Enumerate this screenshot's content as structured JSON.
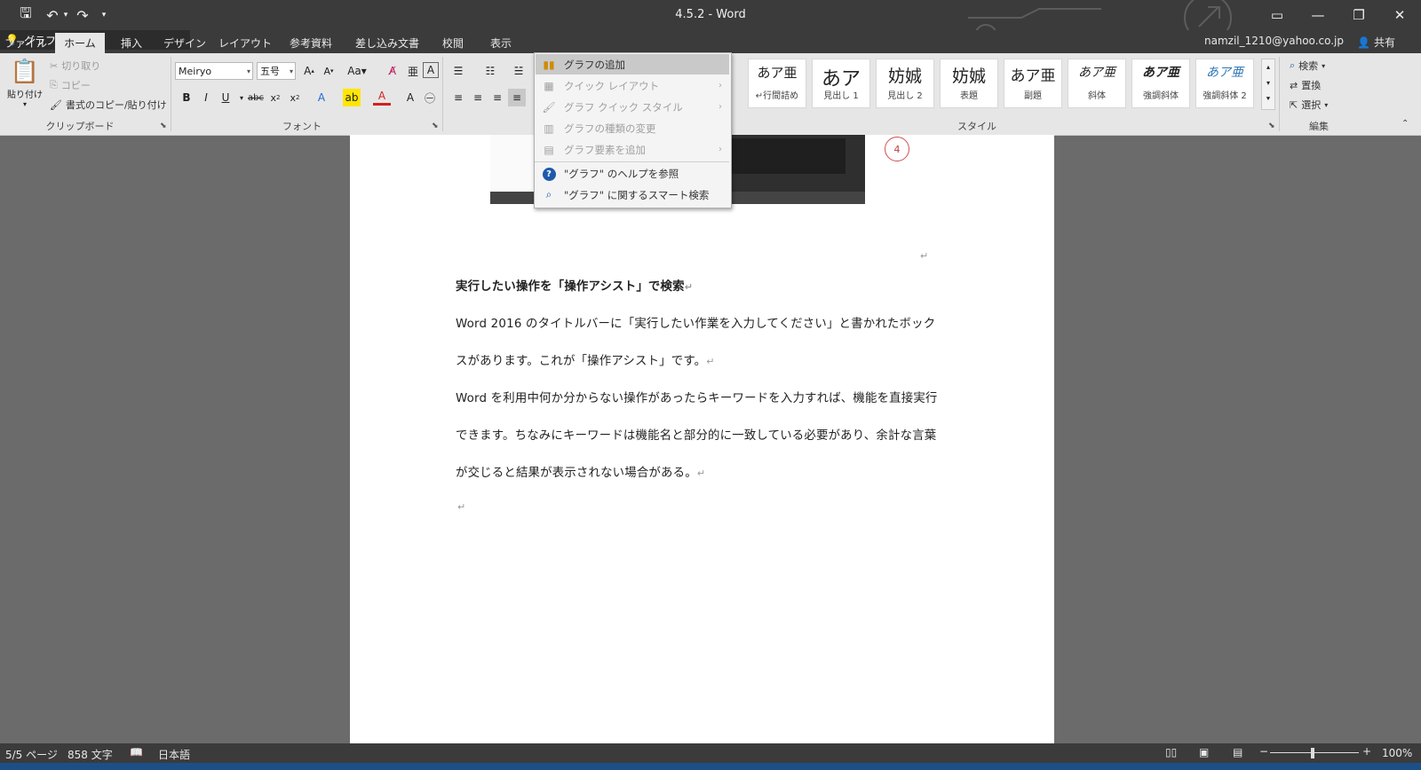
{
  "app": {
    "window_title": "4.5.2 - Word",
    "account": "namzil_1210@yahoo.co.jp",
    "share_label": "共有"
  },
  "tabs": [
    "ファイル",
    "ホーム",
    "挿入",
    "デザイン",
    "レイアウト",
    "参考資料",
    "差し込み文書",
    "校閲",
    "表示"
  ],
  "active_tab": "ホーム",
  "tell_me": {
    "value": "グラフ"
  },
  "ribbon": {
    "clipboard": {
      "paste": "貼り付け",
      "cut": "切り取り",
      "copy": "コピー",
      "format_painter": "書式のコピー/貼り付け",
      "group_label": "クリップボード"
    },
    "font": {
      "font_name": "Meiryo",
      "font_size": "五号",
      "group_label": "フォント"
    },
    "styles": {
      "group_label": "スタイル",
      "items": [
        {
          "sample": "あア亜",
          "name": "↵行間詰め"
        },
        {
          "sample": "あア",
          "name": "見出し 1"
        },
        {
          "sample": "妨娍",
          "name": "見出し 2"
        },
        {
          "sample": "妨娍",
          "name": "表題"
        },
        {
          "sample": "あア亜",
          "name": "副題"
        },
        {
          "sample": "あア亜",
          "name": "斜体"
        },
        {
          "sample": "あア亜",
          "name": "強調斜体"
        },
        {
          "sample": "あア亜",
          "name": "強調斜体 2"
        }
      ]
    },
    "editing": {
      "find": "検索",
      "replace": "置換",
      "select": "選択",
      "group_label": "編集"
    }
  },
  "dropdown": [
    {
      "label": "グラフの追加",
      "icon": "chart-icon",
      "state": "active",
      "submenu": false
    },
    {
      "label": "クイック レイアウト",
      "icon": "layout-icon",
      "state": "disabled",
      "submenu": true
    },
    {
      "label": "グラフ クイック スタイル",
      "icon": "brush-icon",
      "state": "disabled",
      "submenu": true
    },
    {
      "label": "グラフの種類の変更",
      "icon": "chart-type-icon",
      "state": "disabled",
      "submenu": false
    },
    {
      "label": "グラフ要素を追加",
      "icon": "chart-element-icon",
      "state": "disabled",
      "submenu": true
    },
    {
      "label": "\"グラフ\" のヘルプを参照",
      "icon": "help-icon",
      "state": "normal",
      "submenu": false
    },
    {
      "label": "\"グラフ\" に関するスマート検索",
      "icon": "smart-search-icon",
      "state": "normal",
      "submenu": false
    }
  ],
  "document": {
    "callout_number": "4",
    "heading": "実行したい操作を「操作アシスト」で検索",
    "lines": [
      "Word 2016 のタイトルバーに「実行したい作業を入力してください」と書かれたボック",
      "スがあります。これが「操作アシスト」です。",
      "Word を利用中何か分からない操作があったらキーワードを入力すれば、機能を直接実行",
      "できます。ちなみにキーワードは機能名と部分的に一致している必要があり、余計な言葉",
      "が交じると結果が表示されない場合がある。"
    ],
    "para_mark": "↵"
  },
  "status": {
    "page": "5/5 ページ",
    "words": "858 文字",
    "language": "日本語",
    "zoom": "100%",
    "zoom_level": 1.0
  }
}
